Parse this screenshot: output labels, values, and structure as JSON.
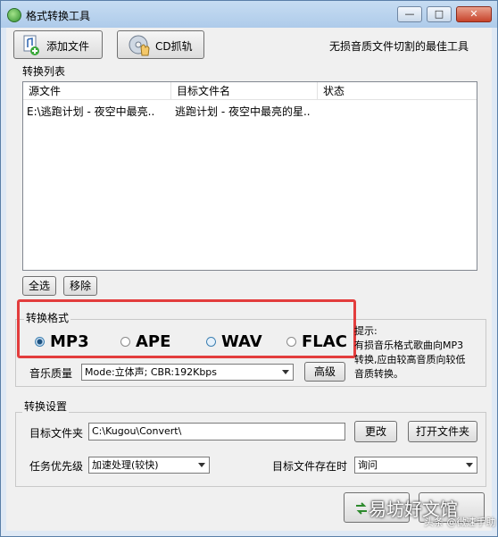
{
  "window": {
    "title": "格式转换工具",
    "min_glyph": "—",
    "max_glyph": "□",
    "close_glyph": "✕"
  },
  "toolbar": {
    "add_file": "添加文件",
    "cd_rip": "CD抓轨",
    "slogan": "无损音质文件切割的最佳工具"
  },
  "convert_list": {
    "label": "转换列表",
    "columns": [
      "源文件",
      "目标文件名",
      "状态"
    ],
    "rows": [
      {
        "source": "E:\\逃跑计划 - 夜空中最亮..",
        "target": "逃跑计划 - 夜空中最亮的星..",
        "status": ""
      }
    ],
    "select_all": "全选",
    "remove": "移除"
  },
  "format": {
    "label": "转换格式",
    "options": [
      "MP3",
      "APE",
      "WAV",
      "FLAC"
    ],
    "selected": "MP3",
    "quality_label": "音乐质量",
    "quality_value": "Mode:立体声; CBR:192Kbps",
    "advanced": "高级"
  },
  "tip": {
    "title": "提示:",
    "lines": [
      "有损音乐格式歌曲向MP3",
      "转换,应由较高音质向较低",
      "音质转换。"
    ]
  },
  "settings": {
    "label": "转换设置",
    "target_folder_label": "目标文件夹",
    "target_folder_value": "C:\\Kugou\\Convert\\",
    "change": "更改",
    "open_folder": "打开文件夹",
    "priority_label": "任务优先级",
    "priority_value": "加速处理(较快)",
    "exists_label": "目标文件存在时",
    "exists_value": "询问"
  },
  "watermark": {
    "main": "易坊好文馆",
    "sub": "头条 @微速手助"
  }
}
